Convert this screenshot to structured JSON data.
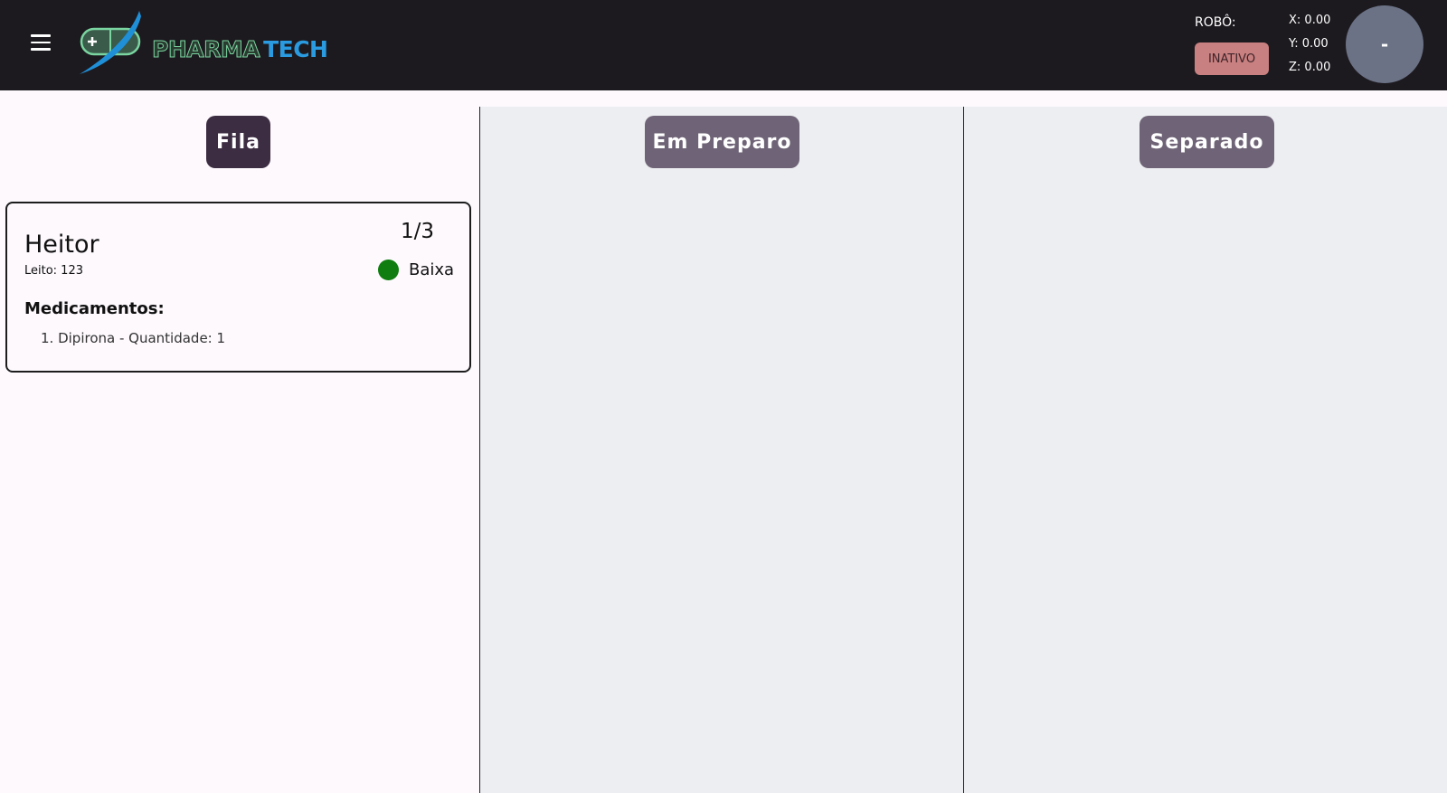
{
  "header": {
    "logo_text_1": "PHARMA",
    "logo_text_2": "TECH",
    "robot_label": "ROBÔ:",
    "robot_status": "INATIVO",
    "coords": {
      "x": "X: 0.00",
      "y": "Y: 0.00",
      "z": "Z: 0.00"
    },
    "avatar_text": "-"
  },
  "columns": [
    {
      "title": "Fila"
    },
    {
      "title": "Em Preparo"
    },
    {
      "title": "Separado"
    }
  ],
  "cards": [
    {
      "name": "Heitor",
      "bed": "Leito: 123",
      "count": "1/3",
      "priority": "Baixa",
      "meds_title": "Medicamentos:",
      "meds": [
        "1. Dipirona - Quantidade: 1"
      ]
    }
  ],
  "colors": {
    "topbar": "#1d1a1f",
    "status_inactive": "#c98080",
    "priority_low": "#0f7d0f",
    "column_active": "#3d2d42",
    "column_inactive": "#6f6477"
  }
}
